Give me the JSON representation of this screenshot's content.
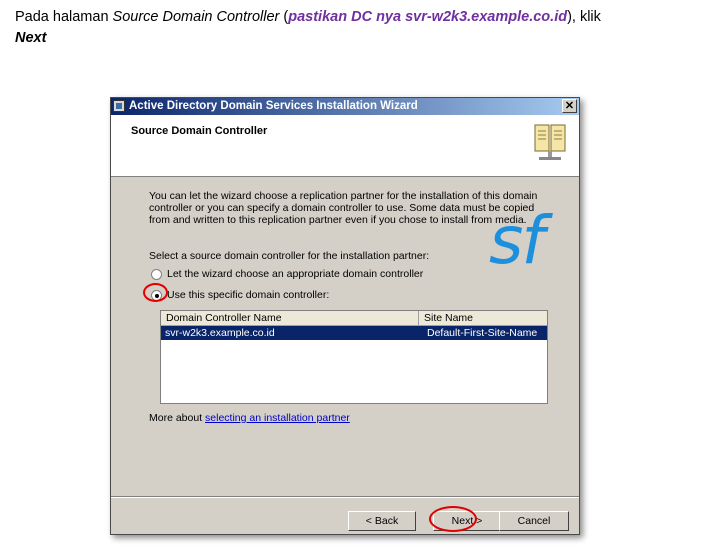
{
  "doc": {
    "intro": "Pada halaman ",
    "page_name": "Source Domain Controller",
    "paren_open": " (",
    "highlight": "pastikan DC nya svr-w2k3.example.co.id",
    "paren_close": "), klik",
    "next_word": "Next"
  },
  "dialog": {
    "title": "Active Directory Domain Services Installation Wizard",
    "close_glyph": "✕",
    "heading": "Source Domain Controller",
    "intro_text": "You can let the wizard choose a replication partner for the installation of this domain controller or you can specify a domain controller to use. Some data must be copied from and written to this replication partner even if you chose to install from media.",
    "select_label": "Select a source domain controller for the installation partner:",
    "option_auto": "Let the wizard choose an appropriate domain controller",
    "option_specific": "Use this specific domain controller:",
    "selected_option": "specific",
    "table": {
      "columns": [
        "Domain Controller Name",
        "Site Name"
      ],
      "rows": [
        {
          "name": "svr-w2k3.example.co.id",
          "site": "Default-First-Site-Name"
        }
      ]
    },
    "more_prefix": "More about ",
    "more_link": "selecting an installation partner",
    "logo_text": "sf",
    "buttons": {
      "back": "< Back",
      "next": "Next >",
      "cancel": "Cancel"
    }
  },
  "icons": [
    "app-icon",
    "close-icon",
    "book-icon"
  ],
  "colors": {
    "annotation_red": "#e00000",
    "highlight_purple": "#7030a0",
    "selection_blue": "#0a246a",
    "logo_blue": "#1e8fdc"
  }
}
